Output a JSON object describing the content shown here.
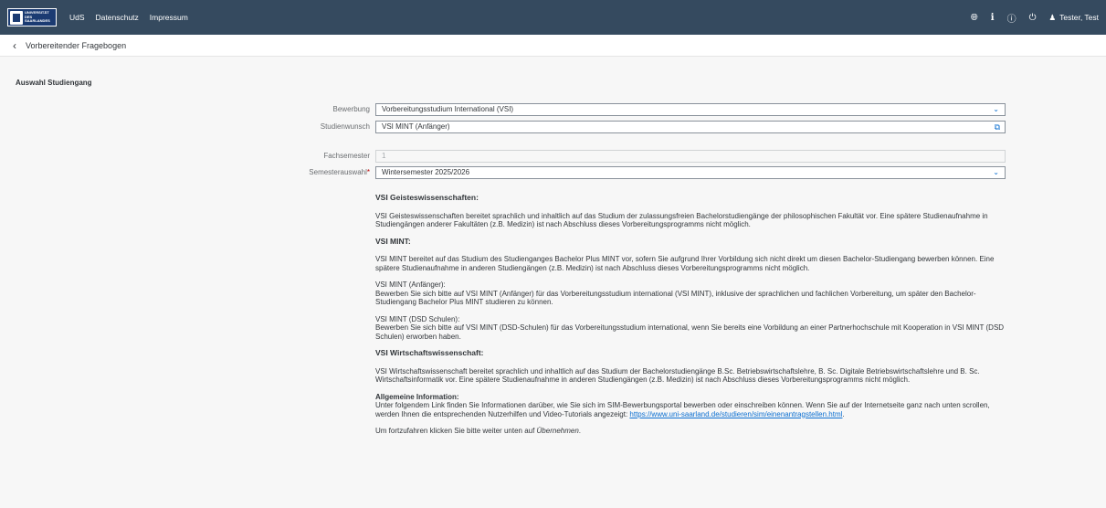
{
  "shell": {
    "logo_text": [
      "UNIVERSITÄT",
      "DES",
      "SAARLANDES"
    ],
    "nav": [
      "UdS",
      "Datenschutz",
      "Impressum"
    ],
    "user": "Tester, Test"
  },
  "subheader": {
    "title": "Vorbereitender Fragebogen"
  },
  "section": {
    "title": "Auswahl Studiengang"
  },
  "form": {
    "bewerbung_label": "Bewerbung",
    "bewerbung_value": "Vorbereitungsstudium International (VSI)",
    "studienwunsch_label": "Studienwunsch",
    "studienwunsch_value": "VSI MINT (Anfänger)",
    "fachsemester_label": "Fachsemester",
    "fachsemester_value": "1",
    "semester_label": "Semesterauswahl",
    "semester_required": "*",
    "semester_value": "Wintersemester 2025/2026"
  },
  "info": {
    "h_geist": "VSI Geisteswissenschaften:",
    "p_geist": "VSI Geisteswissenschaften bereitet sprachlich und inhaltlich auf das Studium der zulassungsfreien Bachelorstudiengänge der philosophischen Fakultät vor. Eine spätere Studienaufnahme in Studiengängen anderer Fakultäten (z.B. Medizin) ist nach Abschluss dieses Vorbereitungsprogramms nicht möglich.",
    "h_mint": "VSI MINT:",
    "p_mint": "VSI MINT bereitet auf das Studium des Studienganges Bachelor Plus MINT vor, sofern Sie aufgrund Ihrer Vorbildung sich nicht direkt um diesen Bachelor-Studiengang bewerben können. Eine spätere Studienaufnahme in anderen Studiengängen (z.B. Medizin) ist nach Abschluss dieses Vorbereitungsprogramms nicht möglich.",
    "mint_anf_title": "VSI MINT (Anfänger):",
    "mint_anf_text": "Bewerben Sie sich bitte auf VSI MINT (Anfänger) für das Vorbereitungsstudium international (VSI MINT), inklusive der sprachlichen und fachlichen Vorbereitung, um später den Bachelor-Studiengang Bachelor Plus MINT studieren zu können.",
    "mint_dsd_title": "VSI MINT (DSD Schulen):",
    "mint_dsd_text": "Bewerben Sie sich bitte auf VSI MINT (DSD-Schulen) für das Vorbereitungsstudium international, wenn Sie bereits eine Vorbildung an einer Partnerhochschule mit Kooperation in VSI MINT (DSD Schulen) erworben haben.",
    "h_wiwi": "VSI Wirtschaftswissenschaft:",
    "p_wiwi": "VSI Wirtschaftswissenschaft bereitet sprachlich und inhaltlich auf das Studium der Bachelorstudiengänge B.Sc. Betriebswirtschaftslehre, B. Sc. Digitale Betriebswirtschaftslehre und B. Sc. Wirtschaftsinformatik vor. Eine spätere Studienaufnahme in anderen Studiengängen (z.B. Medizin) ist nach Abschluss dieses Vorbereitungsprogramms nicht möglich.",
    "allg_title": "Allgemeine Information:",
    "allg_text": "Unter folgendem Link finden Sie Informationen darüber, wie Sie sich im SIM-Bewerbungsportal bewerben oder einschreiben können. Wenn Sie auf der Internetseite ganz nach unten scrollen, werden Ihnen die entsprechenden Nutzerhilfen und Video-Tutorials angezeigt: ",
    "allg_link": "https://www.uni-saarland.de/studieren/sim/einenantragstellen.html",
    "allg_end": ".",
    "final_pre": "Um fortzufahren klicken Sie bitte weiter unten auf ",
    "final_em": "Übernehmen",
    "final_post": "."
  },
  "icons": {
    "globe": "globe-icon",
    "info": "info-icon",
    "help": "help-icon",
    "power": "power-icon",
    "user": "user-icon",
    "back": "chevron-left-icon",
    "dropdown": "chevron-down-icon",
    "valuehelp": "value-help-icon"
  }
}
